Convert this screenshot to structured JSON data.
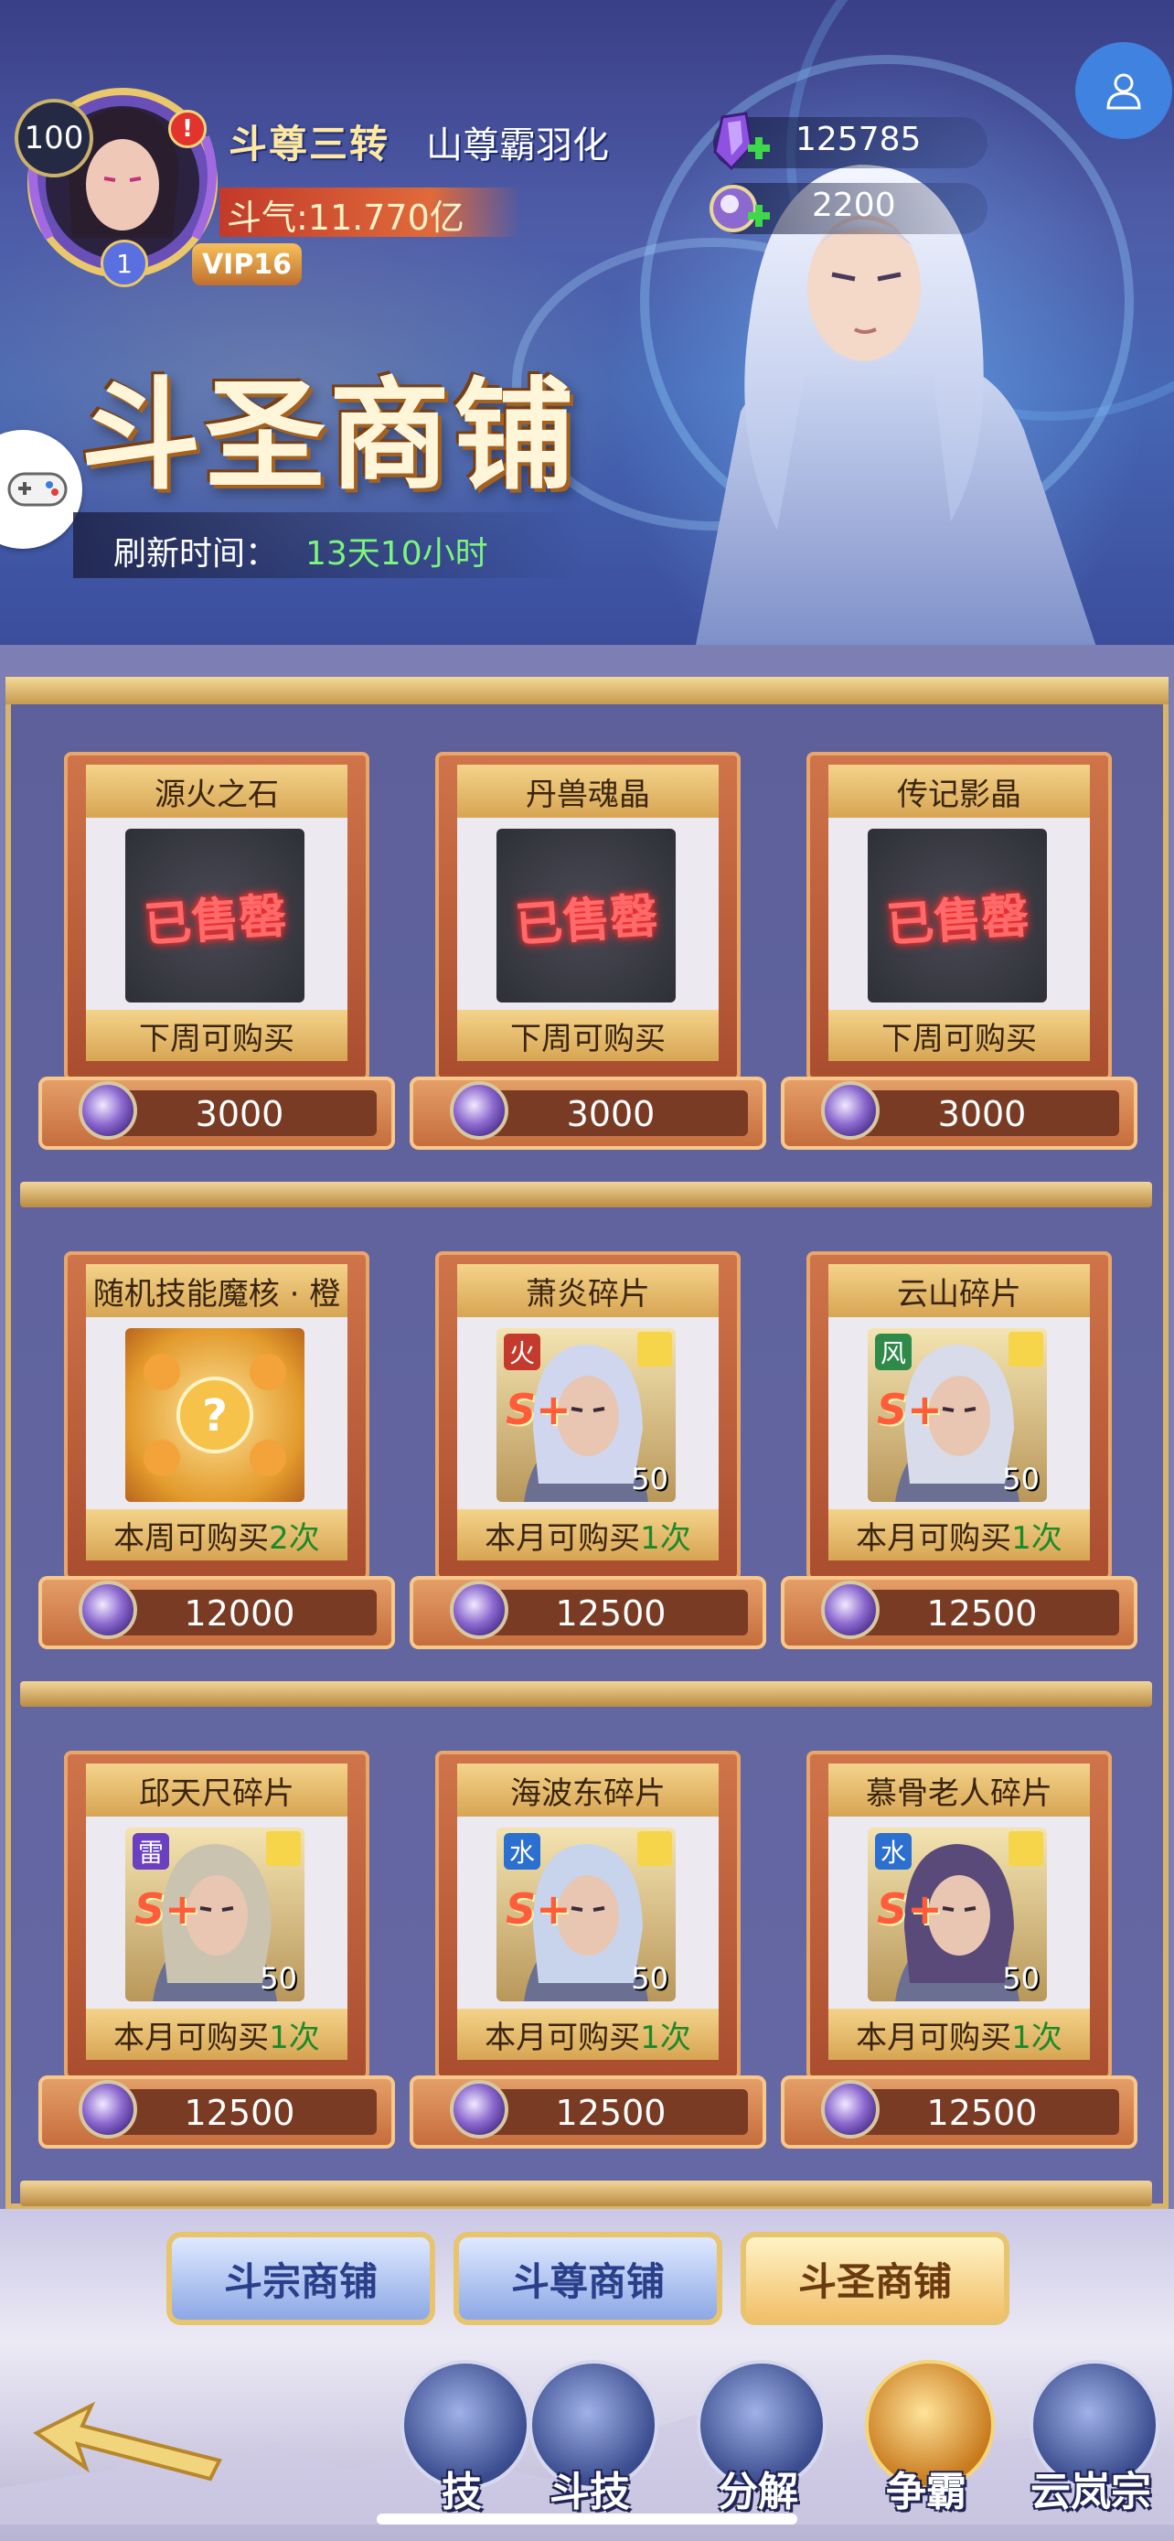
{
  "player": {
    "level": "100",
    "rank": "斗尊三转",
    "name": "山尊霸羽化",
    "power": "斗气:11.770亿",
    "vip": "VIP16",
    "avatar_badge": "1"
  },
  "resources": [
    {
      "icon": "purple-crystal-icon",
      "value": "125785"
    },
    {
      "icon": "orb-coin-icon",
      "value": "2200"
    }
  ],
  "shop": {
    "title": "斗圣商铺",
    "refresh_label": "刷新时间：",
    "refresh_value": "13天10小时"
  },
  "items": [
    {
      "name": "源火之石",
      "sold": "已售罄",
      "limit": "下周可购买",
      "limit_count": "",
      "price": "3000"
    },
    {
      "name": "丹兽魂晶",
      "sold": "已售罄",
      "limit": "下周可购买",
      "limit_count": "",
      "price": "3000"
    },
    {
      "name": "传记影晶",
      "sold": "已售罄",
      "limit": "下周可购买",
      "limit_count": "",
      "price": "3000"
    },
    {
      "name": "随机技能魔核 · 橙",
      "sold": "",
      "limit": "本周可购买",
      "limit_count": "2次",
      "price": "12000"
    },
    {
      "name": "萧炎碎片",
      "element": "火",
      "grade": "S+",
      "count": "50",
      "limit": "本月可购买",
      "limit_count": "1次",
      "price": "12500"
    },
    {
      "name": "云山碎片",
      "element": "风",
      "grade": "S+",
      "count": "50",
      "limit": "本月可购买",
      "limit_count": "1次",
      "price": "12500"
    },
    {
      "name": "邱天尺碎片",
      "element": "雷",
      "grade": "S+",
      "count": "50",
      "limit": "本月可购买",
      "limit_count": "1次",
      "price": "12500"
    },
    {
      "name": "海波东碎片",
      "element": "水",
      "grade": "S+",
      "count": "50",
      "limit": "本月可购买",
      "limit_count": "1次",
      "price": "12500"
    },
    {
      "name": "慕骨老人碎片",
      "element": "水",
      "grade": "S+",
      "count": "50",
      "limit": "本月可购买",
      "limit_count": "1次",
      "price": "12500"
    }
  ],
  "tabs": [
    {
      "label": "斗宗商铺",
      "active": false
    },
    {
      "label": "斗尊商铺",
      "active": false
    },
    {
      "label": "斗圣商铺",
      "active": true
    }
  ],
  "nav": [
    {
      "label": "技",
      "icon": "skill-icon"
    },
    {
      "label": "斗技",
      "icon": "battle-skill-icon"
    },
    {
      "label": "分解",
      "icon": "decompose-icon"
    },
    {
      "label": "争霸",
      "icon": "trophy-icon",
      "active": true
    },
    {
      "label": "云岚宗",
      "icon": "sect-icon"
    }
  ],
  "colors": {
    "accent_gold": "#e8c46e",
    "price_bar": "#7a3b24",
    "highlight_green": "#1d8a2a",
    "refresh_green": "#7df57d",
    "sold_red": "#ff6a6a"
  }
}
